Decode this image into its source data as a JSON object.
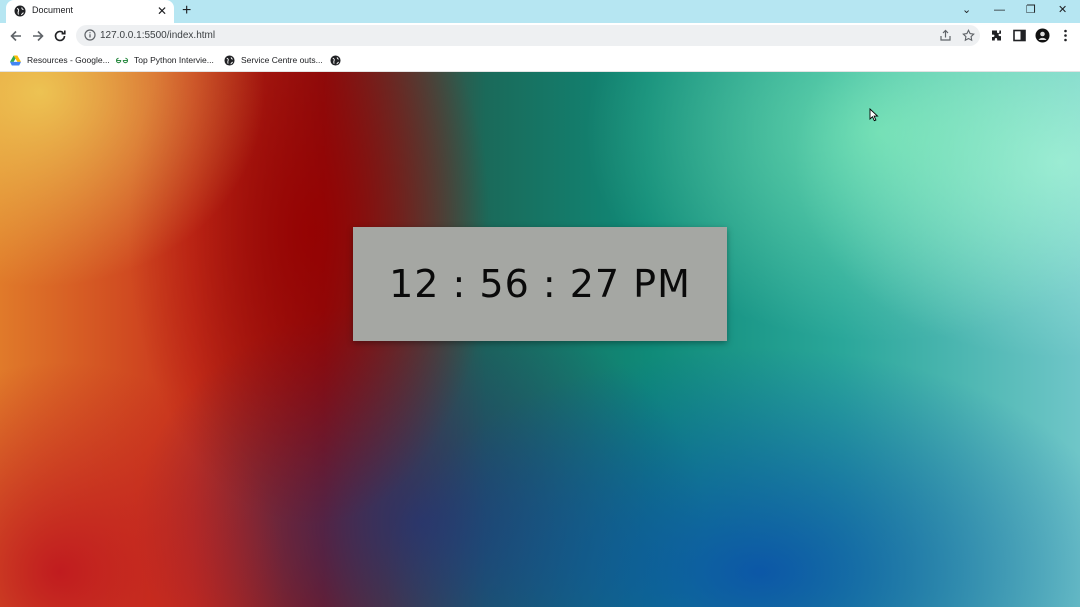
{
  "tab": {
    "title": "Document",
    "close": "✕"
  },
  "new_tab": "+",
  "window_controls": {
    "dropdown": "⌄",
    "minimize": "—",
    "restore": "❐",
    "close": "✕"
  },
  "address_bar": {
    "url": "127.0.0.1:5500/index.html"
  },
  "bookmarks": [
    {
      "label": "Resources - Google...",
      "icon": "drive-icon"
    },
    {
      "label": "Top Python Intervie...",
      "icon": "gfg-icon"
    },
    {
      "label": "Service Centre outs...",
      "icon": "globe-icon"
    },
    {
      "label": "",
      "icon": "globe-icon"
    }
  ],
  "clock": {
    "time": "12 : 56 : 27 PM"
  },
  "colors": {
    "tabstrip": "#b6e6f2",
    "clock_box": "#a5a7a3"
  }
}
